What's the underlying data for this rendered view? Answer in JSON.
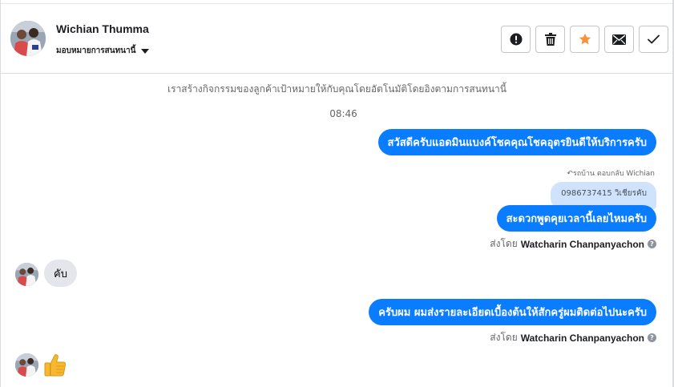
{
  "header": {
    "contact_name": "Wichian Thumma",
    "assign_label": "มอบหมายการสนทนานี้",
    "actions": [
      {
        "name": "report-icon",
        "label": "!"
      },
      {
        "name": "trash-icon",
        "label": ""
      },
      {
        "name": "star-icon",
        "label": "",
        "color": "#f7923b"
      },
      {
        "name": "envelope-icon",
        "label": ""
      },
      {
        "name": "check-icon",
        "label": ""
      }
    ]
  },
  "conversation": {
    "system_note": "เราสร้างกิจกรรมของลูกค้าเป้าหมายให้กับคุณโดยอัตโนมัติโดยอิงตามการสนทนานี้",
    "time": "08:46",
    "messages": [
      {
        "text": "สวัสดีครับแอดมินแบงค์โชคคุณโชคอุตรยินดีให้บริการครับ"
      },
      {
        "reply_hint": "↶รถบ้าน ตอบกลับ Wichian",
        "quoted": "0986737415 วิเชียรคับ",
        "text": "สะดวกพูดคุยเวลานี้เลยไหมครับ"
      },
      {
        "incoming": "คับ"
      },
      {
        "text": "ครับผม ผมส่งรายละเอียดเบื้องต้นให้สักครู่ผมติดต่อไปนะครับ"
      }
    ],
    "sent_by_prefix": "ส่งโดย",
    "sent_by_name": "Watcharin Chanpanyachon",
    "help_glyph": "?",
    "thumb_emoji": "thumbs-up-icon"
  },
  "colors": {
    "outgoing_bubble": "#0a7cff",
    "incoming_bubble": "#e4e6eb",
    "quoted_bubble": "#cfe3fd",
    "star": "#f7923b"
  }
}
